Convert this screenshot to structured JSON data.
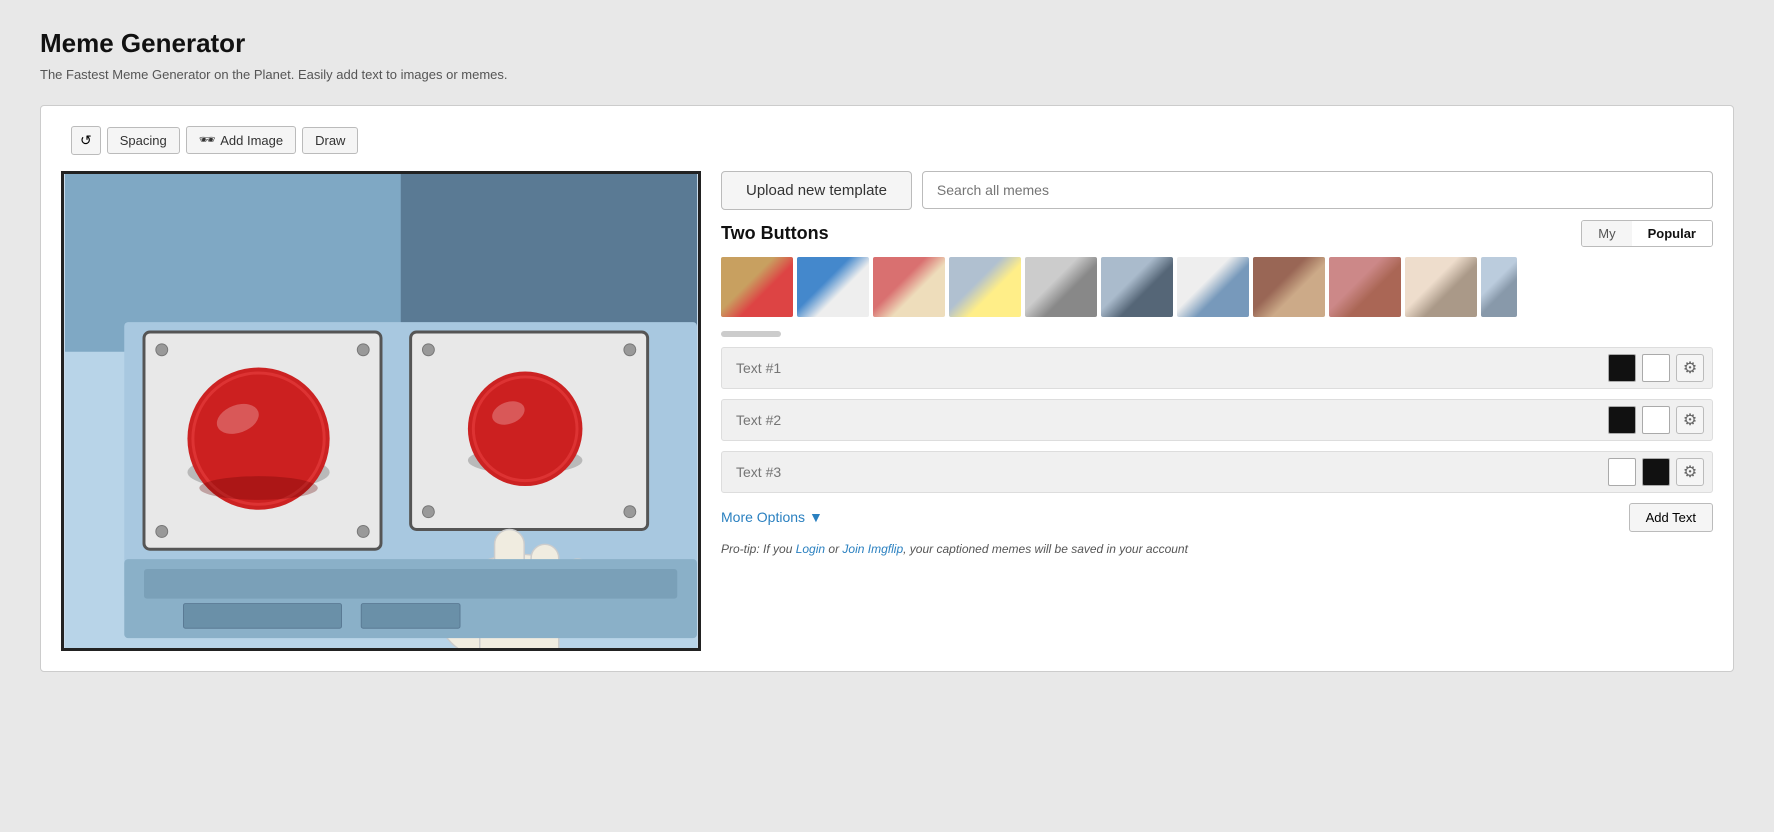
{
  "header": {
    "title": "Meme Generator",
    "subtitle": "The Fastest Meme Generator on the Planet. Easily add text to images or memes."
  },
  "toolbar": {
    "reset_icon": "↺",
    "spacing_label": "Spacing",
    "add_image_label": "Add Image",
    "draw_label": "Draw",
    "sunglasses_icon": "🕶"
  },
  "top_actions": {
    "upload_label": "Upload new template",
    "search_placeholder": "Search all memes"
  },
  "meme_selector": {
    "title": "Two Buttons",
    "tab_my": "My",
    "tab_popular": "Popular"
  },
  "text_fields": [
    {
      "placeholder": "Text #1",
      "swatch_left": "black",
      "swatch_right": "white"
    },
    {
      "placeholder": "Text #2",
      "swatch_left": "black",
      "swatch_right": "white"
    },
    {
      "placeholder": "Text #3",
      "swatch_left": "white",
      "swatch_right": "black"
    }
  ],
  "more_options": {
    "label": "More Options",
    "arrow": "▼"
  },
  "add_text": {
    "label": "Add Text"
  },
  "protip": {
    "text_before": "Pro-tip: If you ",
    "login_label": "Login",
    "join_label": "Join Imgflip",
    "text_after": ", your captioned memes will be saved in your account"
  }
}
